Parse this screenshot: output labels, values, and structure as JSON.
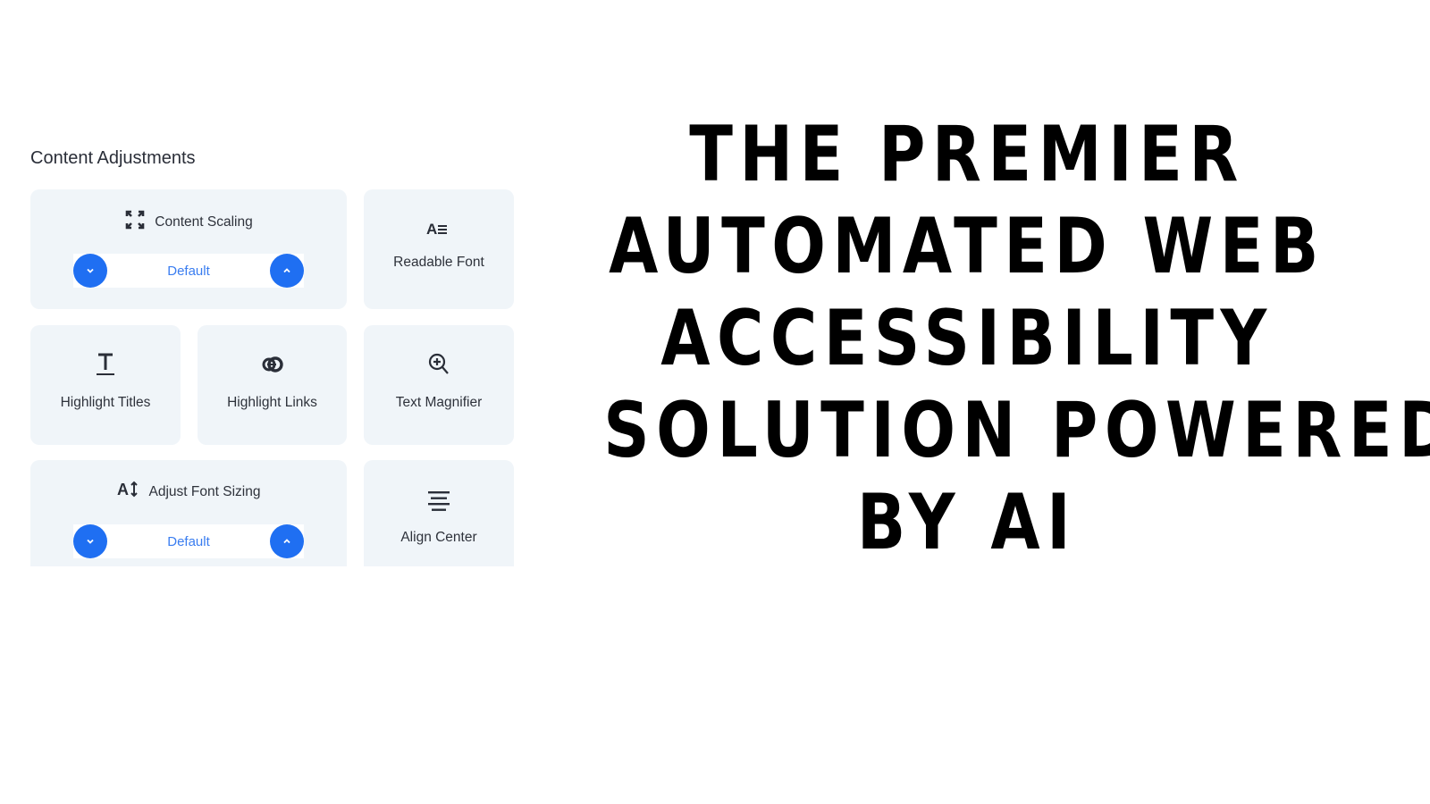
{
  "panel": {
    "title": "Content Adjustments",
    "cards": {
      "content_scaling": {
        "label": "Content Scaling",
        "icon": "expand-arrows-icon",
        "value": "Default"
      },
      "readable_font": {
        "label": "Readable Font",
        "icon": "readable-font-icon"
      },
      "highlight_titles": {
        "label": "Highlight Titles",
        "icon": "underlined-t-icon"
      },
      "highlight_links": {
        "label": "Highlight Links",
        "icon": "link-icon"
      },
      "text_magnifier": {
        "label": "Text Magnifier",
        "icon": "zoom-in-icon"
      },
      "adjust_font_sizing": {
        "label": "Adjust Font Sizing",
        "icon": "font-size-icon",
        "value": "Default"
      },
      "align_center": {
        "label": "Align Center",
        "icon": "align-center-icon"
      }
    },
    "stepper_icons": {
      "decrease": "chevron-down-icon",
      "increase": "chevron-up-icon"
    }
  },
  "headline": {
    "lines": [
      "THE PREMIER",
      "AUTOMATED WEB",
      "ACCESSIBILITY",
      "SOLUTION POWERED",
      "BY AI"
    ]
  },
  "colors": {
    "accent": "#1f6ff2",
    "card_bg": "#f0f5f9",
    "text": "#2a2e38",
    "value_text": "#3a7df0"
  }
}
